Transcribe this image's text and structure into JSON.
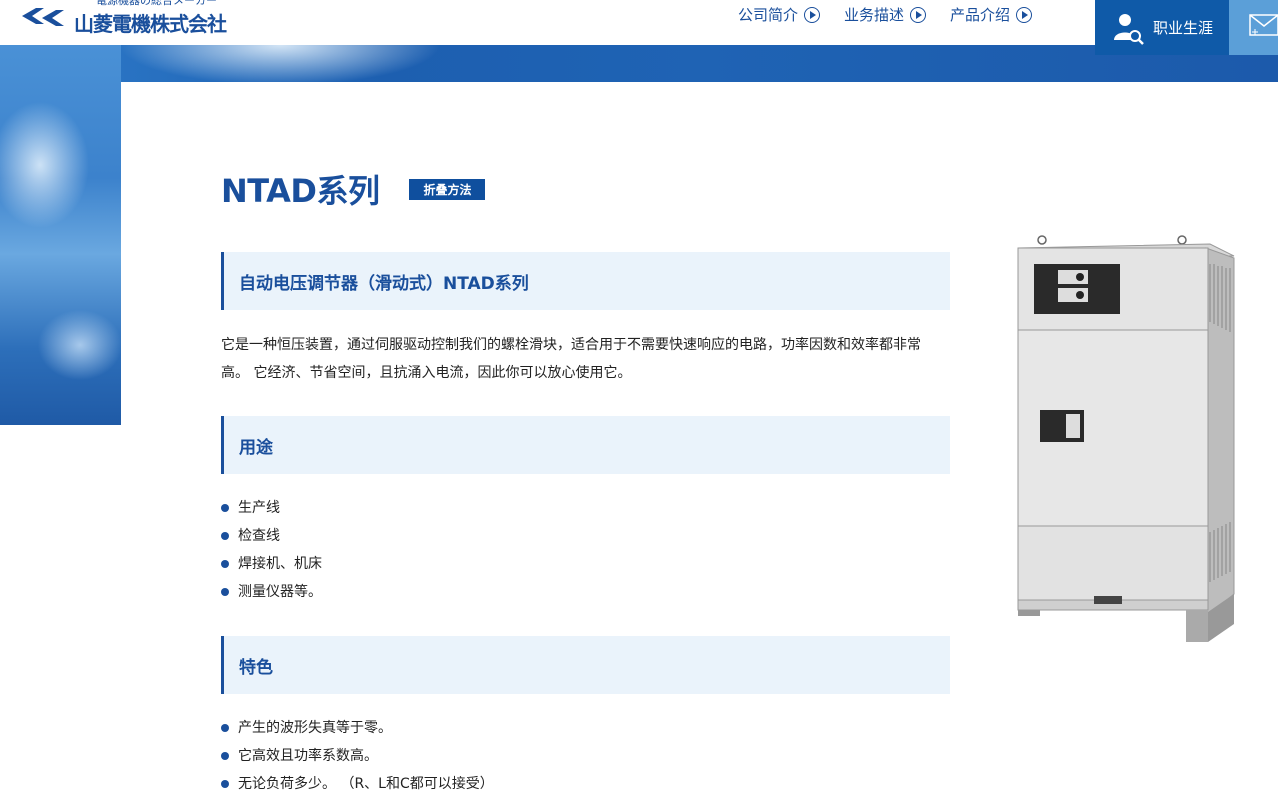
{
  "header": {
    "tagline": "電源機器の総合メーカー",
    "company_name": "山菱電機株式会社",
    "nav": [
      {
        "label": "公司简介"
      },
      {
        "label": "业务描述"
      },
      {
        "label": "产品介绍"
      }
    ],
    "career_label": "职业生涯"
  },
  "page": {
    "title": "NTAD系列",
    "fold_label": "折叠方法"
  },
  "sections": {
    "intro": {
      "heading": "自动电压调节器（滑动式）NTAD系列",
      "text": "它是一种恒压装置，通过伺服驱动控制我们的螺栓滑块，适合用于不需要快速响应的电路，功率因数和效率都非常高。 它经济、节省空间，且抗涌入电流，因此你可以放心使用它。"
    },
    "usage": {
      "heading": "用途",
      "items": [
        "生产线",
        "检查线",
        "焊接机、机床",
        "测量仪器等。"
      ]
    },
    "features": {
      "heading": "特色",
      "items": [
        "产生的波形失真等于零。",
        "它高效且功率系数高。",
        "无论负荷多少。 （R、L和C都可以接受）"
      ]
    }
  },
  "colors": {
    "brand": "#1a4f9c",
    "career_bg": "#0f5aa8",
    "section_bg": "#eaf3fb"
  }
}
